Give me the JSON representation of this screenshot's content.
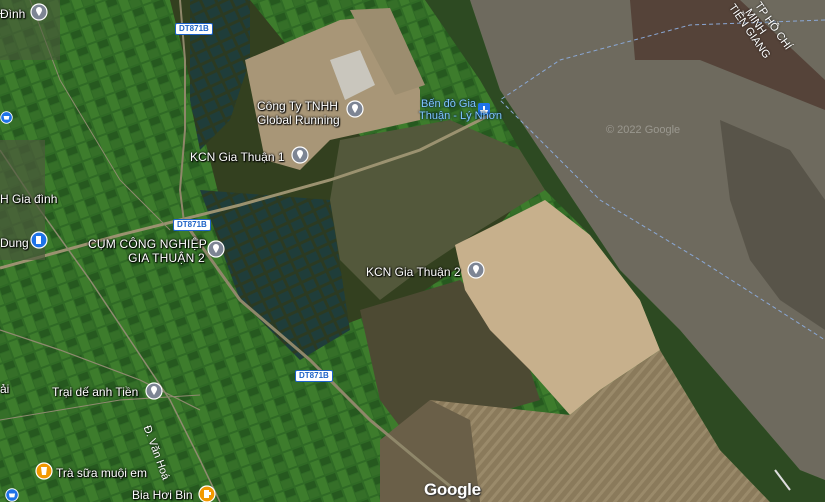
{
  "map": {
    "labels": {
      "global_running_l1": "Công Ty TNHH",
      "global_running_l2": "Global Running",
      "ferry_l1": "Bến đò Gia",
      "ferry_l2": "Thuận - Lý Nhơn",
      "kcn1": "KCN Gia Thuận 1",
      "kcn2": "KCN Gia Thuận 2",
      "ccn_l1": "CỤM CÔNG NGHIỆP",
      "ccn_l2": "GIA THUẬN 2",
      "trai": "Trại dế anh Tiền",
      "tra_sua": "Trà sữa muội em",
      "bia": "Bia Hơi Bin",
      "h_gia_dinh": "H Gia đình",
      "dinh_top": "Đình",
      "dung": "Dung",
      "ai": "ải",
      "van_hoa": "Đ. Văn Hoá",
      "province_l1": "TP HỒ CHÍ MINH",
      "province_l2": "TIỀN GIANG"
    },
    "roads": {
      "dt871b_1": "DT871B",
      "dt871b_2": "DT871B",
      "dt871b_3": "DT871B"
    },
    "copyright": "© 2022 Google",
    "logo": "Google"
  }
}
